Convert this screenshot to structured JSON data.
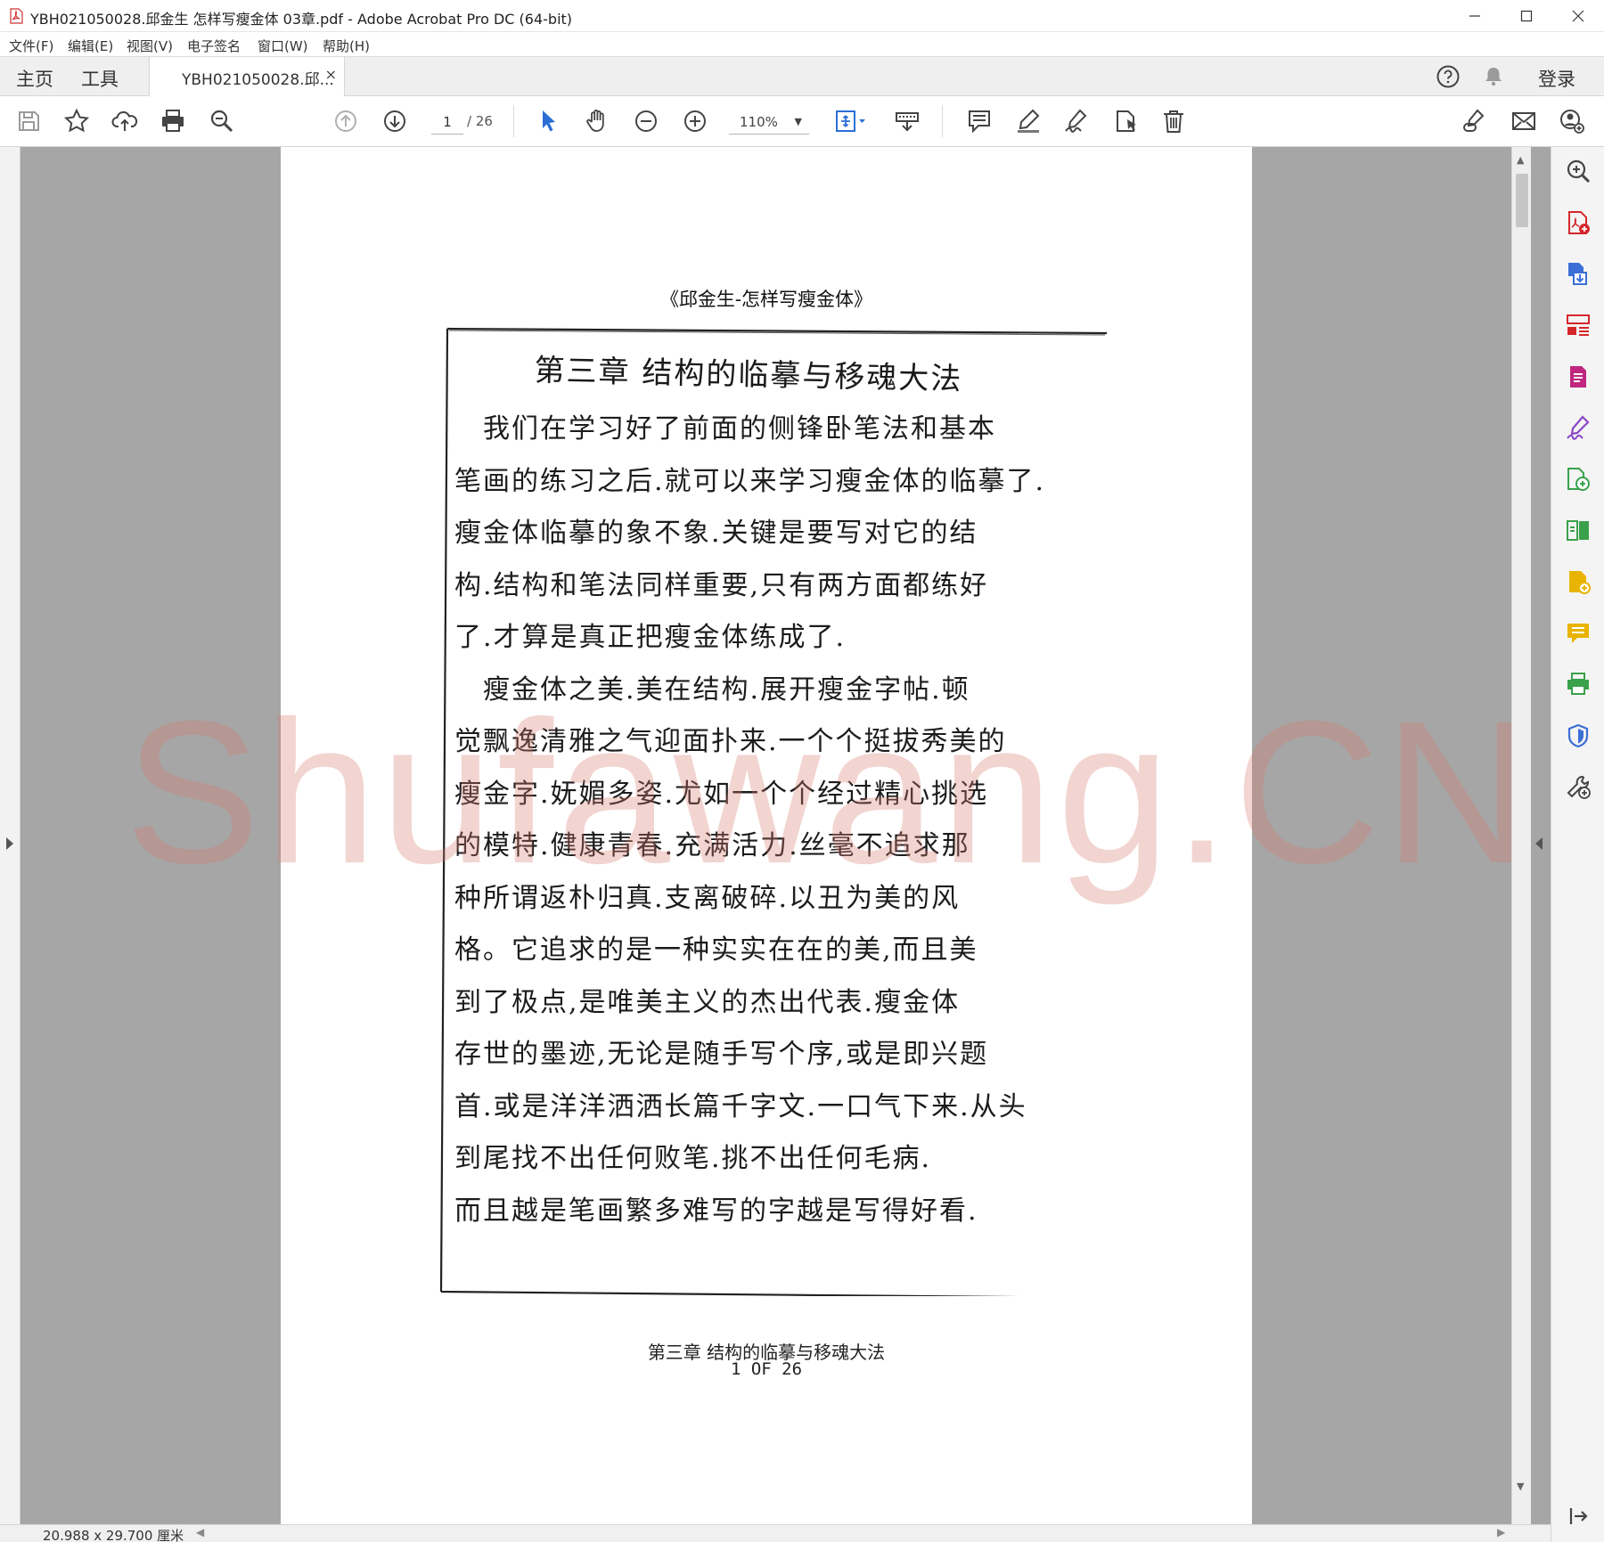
{
  "window": {
    "title": "YBH021050028.邱金生 怎样写瘦金体 03章.pdf - Adobe Acrobat Pro DC (64-bit)"
  },
  "menu": [
    "文件(F)",
    "编辑(E)",
    "视图(V)",
    "电子签名",
    "窗口(W)",
    "帮助(H)"
  ],
  "tabs": {
    "home": "主页",
    "tools": "工具",
    "document": "YBH021050028.邱...",
    "close_glyph": "×",
    "login": "登录"
  },
  "toolbar": {
    "current_page": "1",
    "page_total": "/ 26",
    "zoom": "110%"
  },
  "page": {
    "running_header": "《邱金生-怎样写瘦金体》",
    "scan_title": "第三章 结构的临摹与移魂大法",
    "scan_lines": [
      "　我们在学习好了前面的侧锋卧笔法和基本",
      "笔画的练习之后.就可以来学习瘦金体的临摹了.",
      "瘦金体临摹的象不象.关键是要写对它的结",
      "构.结构和笔法同样重要,只有两方面都练好",
      "了.才算是真正把瘦金体练成了.",
      "　瘦金体之美.美在结构.展开瘦金字帖.顿",
      "觉飘逸清雅之气迎面扑来.一个个挺拔秀美的",
      "瘦金字.妩媚多姿.尤如一个个经过精心挑选",
      "的模特.健康青春.充满活力.丝毫不追求那",
      "种所谓返朴归真.支离破碎.以丑为美的风",
      "格。它追求的是一种实实在在的美,而且美",
      "到了极点,是唯美主义的杰出代表.瘦金体",
      "存世的墨迹,无论是随手写个序,或是即兴题",
      "首.或是洋洋洒洒长篇千字文.一口气下来.从头",
      "到尾找不出任何败笔.挑不出任何毛病.",
      "而且越是笔画繁多难写的字越是写得好看."
    ],
    "footer_chapter": "第三章  结构的临摹与移魂大法",
    "footer_page": "1 OF 26"
  },
  "watermark": "Shufawang.CN",
  "status": {
    "page_size": "20.988 x 29.700 厘米"
  },
  "colors": {
    "acrobat_red": "#d4272a",
    "toolbar_blue": "#2b6fd6",
    "panel_green": "#3aa14b",
    "panel_purple": "#8a46c8",
    "panel_yellow": "#e8b400",
    "watermark": "#d6786e"
  },
  "icons": {
    "toolbar": [
      "save-icon",
      "bookmark-star-icon",
      "upload-cloud-icon",
      "print-icon",
      "search-zoom-icon",
      "previous-page-icon",
      "next-page-icon",
      "select-cursor-icon",
      "hand-icon",
      "zoom-out-icon",
      "zoom-in-icon",
      "fit-page-icon",
      "keyboard-icon",
      "comment-icon",
      "highlight-pen-icon",
      "sign-icon",
      "stamp-icon",
      "delete-icon",
      "share-link-icon",
      "email-icon",
      "add-user-icon"
    ],
    "right_panel": [
      "zoom-search-icon",
      "create-pdf-icon",
      "export-pdf-icon",
      "organize-pages-icon",
      "edit-pdf-icon",
      "fill-sign-icon",
      "compare-icon",
      "combine-files-icon",
      "add-file-icon",
      "comment-panel-icon",
      "print-production-icon",
      "protect-icon",
      "more-tools-icon"
    ]
  }
}
